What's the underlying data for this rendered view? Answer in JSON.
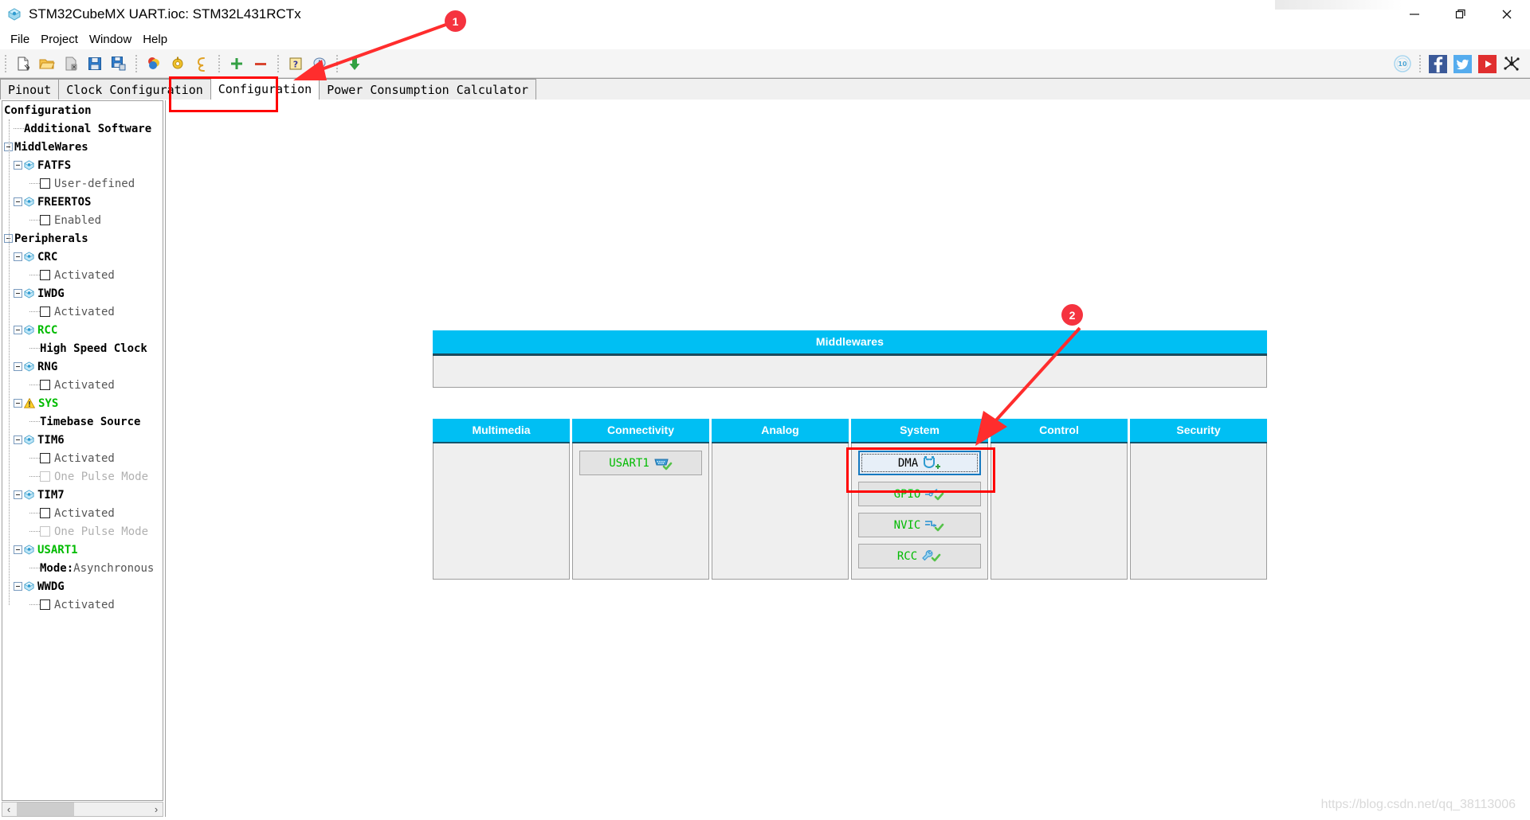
{
  "window": {
    "app_icon": "cube-icon",
    "title": "STM32CubeMX UART.ioc: STM32L431RCTx",
    "minimize_label": "minimize-icon",
    "maximize_label": "maximize-icon",
    "close_label": "close-icon"
  },
  "menubar": {
    "items": [
      {
        "label": "File"
      },
      {
        "label": "Project"
      },
      {
        "label": "Window"
      },
      {
        "label": "Help"
      }
    ]
  },
  "toolbar": {
    "buttons": [
      {
        "name": "new-project-icon",
        "title": "New Project"
      },
      {
        "name": "open-project-icon",
        "title": "Open Project"
      },
      {
        "name": "close-project-icon",
        "title": "Close Project"
      },
      {
        "name": "save-project-icon",
        "title": "Save Project"
      },
      {
        "name": "save-project-as-icon",
        "title": "Save Project As"
      },
      {
        "name": "generate-report-icon",
        "title": "Generate Report"
      },
      {
        "name": "settings-icon",
        "title": "Project Settings"
      },
      {
        "name": "generate-code-icon",
        "title": "Generate Code"
      },
      {
        "name": "zoom-in-icon",
        "title": "Zoom In"
      },
      {
        "name": "zoom-out-icon",
        "title": "Zoom Out"
      },
      {
        "name": "help-icon",
        "title": "Help"
      },
      {
        "name": "about-icon",
        "title": "About"
      },
      {
        "name": "update-icon",
        "title": "Check For Updates"
      }
    ],
    "right_icons": [
      {
        "name": "st-badge-10-icon",
        "label": "10"
      },
      {
        "name": "facebook-icon",
        "label": "f"
      },
      {
        "name": "twitter-icon",
        "label": ""
      },
      {
        "name": "youtube-icon",
        "label": ""
      },
      {
        "name": "st-community-icon",
        "label": ""
      }
    ]
  },
  "tabs": [
    {
      "label": "Pinout",
      "active": false
    },
    {
      "label": "Clock Configuration",
      "active": false
    },
    {
      "label": "Configuration",
      "active": true
    },
    {
      "label": "Power Consumption Calculator",
      "active": false
    }
  ],
  "tree": {
    "root_label": "Configuration",
    "items": [
      {
        "label": "Configuration",
        "level": 0,
        "style": "bold",
        "kind": "root"
      },
      {
        "label": "Additional Software",
        "level": 1,
        "style": "bold",
        "kind": "leaf"
      },
      {
        "label": "MiddleWares",
        "level": 0,
        "style": "bold",
        "kind": "group"
      },
      {
        "label": "FATFS",
        "level": 1,
        "style": "bold",
        "kind": "periph"
      },
      {
        "label": "User-defined",
        "level": 2,
        "style": "plain",
        "kind": "check",
        "checked": false,
        "enabled": true
      },
      {
        "label": "FREERTOS",
        "level": 1,
        "style": "bold",
        "kind": "periph"
      },
      {
        "label": "Enabled",
        "level": 2,
        "style": "plain",
        "kind": "check",
        "checked": false,
        "enabled": true
      },
      {
        "label": "Peripherals",
        "level": 0,
        "style": "bold",
        "kind": "group"
      },
      {
        "label": "CRC",
        "level": 1,
        "style": "bold",
        "kind": "periph"
      },
      {
        "label": "Activated",
        "level": 2,
        "style": "plain",
        "kind": "check",
        "checked": false,
        "enabled": true
      },
      {
        "label": "IWDG",
        "level": 1,
        "style": "bold",
        "kind": "periph"
      },
      {
        "label": "Activated",
        "level": 2,
        "style": "plain",
        "kind": "check",
        "checked": false,
        "enabled": true
      },
      {
        "label": "RCC",
        "level": 1,
        "style": "green",
        "kind": "periph"
      },
      {
        "label": "High Speed Clock",
        "level": 2,
        "style": "bold",
        "kind": "value"
      },
      {
        "label": "RNG",
        "level": 1,
        "style": "bold",
        "kind": "periph"
      },
      {
        "label": "Activated",
        "level": 2,
        "style": "plain",
        "kind": "check",
        "checked": false,
        "enabled": true
      },
      {
        "label": "SYS",
        "level": 1,
        "style": "green",
        "kind": "warn"
      },
      {
        "label": "Timebase Source",
        "level": 2,
        "style": "bold",
        "kind": "value"
      },
      {
        "label": "TIM6",
        "level": 1,
        "style": "bold",
        "kind": "periph"
      },
      {
        "label": "Activated",
        "level": 2,
        "style": "plain",
        "kind": "check",
        "checked": false,
        "enabled": true
      },
      {
        "label": "One Pulse Mode",
        "level": 2,
        "style": "dim",
        "kind": "check",
        "checked": false,
        "enabled": false
      },
      {
        "label": "TIM7",
        "level": 1,
        "style": "bold",
        "kind": "periph"
      },
      {
        "label": "Activated",
        "level": 2,
        "style": "plain",
        "kind": "check",
        "checked": false,
        "enabled": true
      },
      {
        "label": "One Pulse Mode",
        "level": 2,
        "style": "dim",
        "kind": "check",
        "checked": false,
        "enabled": false
      },
      {
        "label": "USART1",
        "level": 1,
        "style": "green",
        "kind": "periph"
      },
      {
        "label": "Mode:Asynchronous",
        "level": 2,
        "style": "bold",
        "kind": "value"
      },
      {
        "label": "WWDG",
        "level": 1,
        "style": "bold",
        "kind": "periph"
      },
      {
        "label": "Activated",
        "level": 2,
        "style": "plain",
        "kind": "check",
        "checked": false,
        "enabled": true
      }
    ],
    "hscroll": {
      "left_arrow": "‹",
      "right_arrow": "›"
    }
  },
  "main": {
    "middlewares": {
      "title": "Middlewares",
      "items": []
    },
    "columns": [
      {
        "title": "Multimedia",
        "items": []
      },
      {
        "title": "Connectivity",
        "items": [
          {
            "label": "USART1",
            "state": "configured",
            "icon": "connector-icon"
          }
        ]
      },
      {
        "title": "Analog",
        "items": []
      },
      {
        "title": "System",
        "items": [
          {
            "label": "DMA",
            "state": "selected",
            "icon": "dma-icon"
          },
          {
            "label": "GPIO",
            "state": "configured",
            "icon": "gpio-icon"
          },
          {
            "label": "NVIC",
            "state": "configured",
            "icon": "nvic-icon"
          },
          {
            "label": "RCC",
            "state": "configured",
            "icon": "wrench-icon"
          }
        ]
      },
      {
        "title": "Control",
        "items": []
      },
      {
        "title": "Security",
        "items": []
      }
    ]
  },
  "annotations": [
    {
      "number": "1",
      "target": "configuration-tab"
    },
    {
      "number": "2",
      "target": "dma-button"
    }
  ],
  "watermark": "https://blog.csdn.net/qq_38113006",
  "colors": {
    "accent_cyan": "#00bff3",
    "annotation_red": "#ff0000",
    "badge_red": "#f5333f",
    "configured_green": "#00bb00",
    "selection_blue": "#1679c0"
  }
}
